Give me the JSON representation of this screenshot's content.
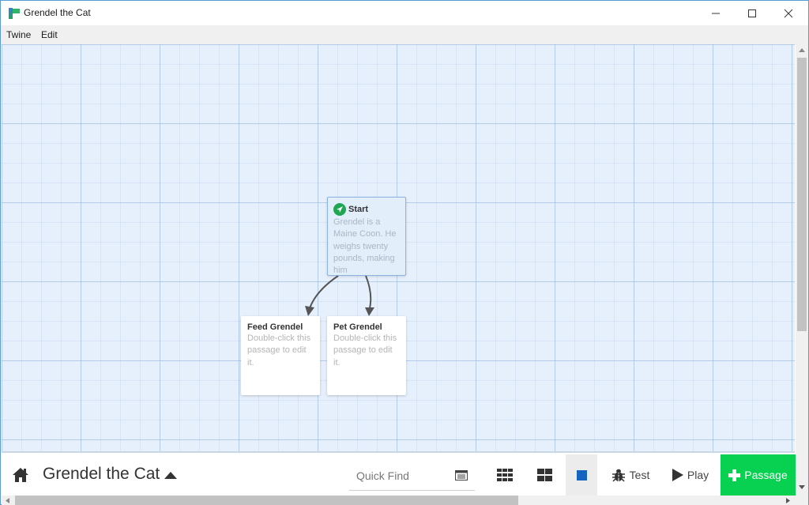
{
  "window": {
    "title": "Grendel the Cat",
    "app_icon": "twine-logo-icon",
    "controls": [
      "minimize-icon",
      "maximize-icon",
      "close-icon"
    ]
  },
  "menubar": {
    "items": [
      {
        "label": "Twine"
      },
      {
        "label": "Edit"
      }
    ]
  },
  "canvas": {
    "passages": [
      {
        "title": "Start",
        "excerpt": "Grendel is a Maine Coon. He weighs twenty pounds, making him",
        "is_start": true,
        "selected": true,
        "icon": "rocket-icon"
      },
      {
        "title": "Feed Grendel",
        "excerpt": "Double-click this passage to edit it.",
        "is_start": false,
        "selected": false
      },
      {
        "title": "Pet Grendel",
        "excerpt": "Double-click this passage to edit it.",
        "is_start": false,
        "selected": false
      }
    ],
    "links": [
      {
        "from": "Start",
        "to": "Feed Grendel"
      },
      {
        "from": "Start",
        "to": "Pet Grendel"
      }
    ]
  },
  "toolbar": {
    "home_icon": "home-icon",
    "story_title": "Grendel the Cat",
    "story_menu_icon": "caret-up-icon",
    "quick_find_placeholder": "Quick Find",
    "quick_find_value": "",
    "buttons": {
      "story_details_icon": "details-icon",
      "zoom_small_icon": "grid-9-icon",
      "zoom_medium_icon": "grid-4-icon",
      "zoom_large_icon": "square-icon",
      "test_label": "Test",
      "play_label": "Play",
      "passage_label": "Passage"
    },
    "active_zoom": "large"
  },
  "colors": {
    "accent_green": "#08d151",
    "start_green": "#1fa754",
    "zoom_blue": "#1565c0",
    "canvas_bg": "#e6f0fc"
  }
}
